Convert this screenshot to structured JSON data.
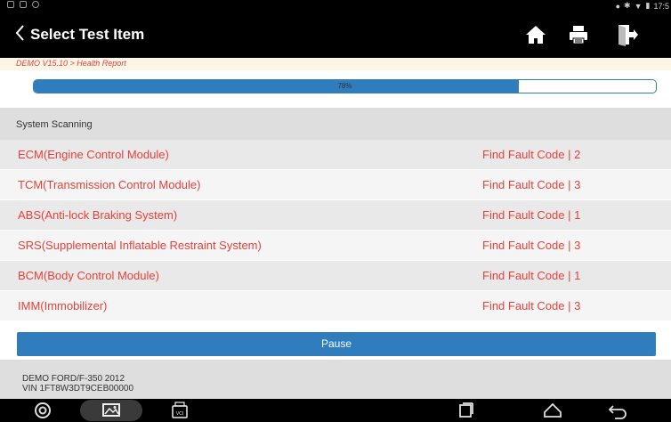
{
  "status_bar": {
    "time": "17:5"
  },
  "header": {
    "title": "Select Test Item",
    "icons": {
      "back": "back-chevron-icon",
      "home": "home-icon",
      "print": "printer-icon",
      "exit": "exit-icon"
    }
  },
  "breadcrumb": "DEMO V15.10 > Health Report",
  "progress": {
    "value": 0.78,
    "label": "78%"
  },
  "section": "System Scanning",
  "modules": [
    {
      "name": "ECM(Engine Control Module)",
      "status": "Find Fault Code | 2"
    },
    {
      "name": "TCM(Transmission Control Module)",
      "status": "Find Fault Code | 3"
    },
    {
      "name": "ABS(Anti-lock Braking System)",
      "status": "Find Fault Code | 1"
    },
    {
      "name": "SRS(Supplemental Inflatable Restraint System)",
      "status": "Find Fault Code | 3"
    },
    {
      "name": "BCM(Body Control Module)",
      "status": "Find Fault Code | 1"
    },
    {
      "name": "IMM(Immobilizer)",
      "status": "Find Fault Code | 3"
    }
  ],
  "pause_label": "Pause",
  "vehicle": {
    "model": "DEMO FORD/F-350 2012",
    "vin": "VIN 1FT8W3DT9CEB00000"
  },
  "nav_bar": {
    "vci_label": "VCI"
  },
  "colors": {
    "accent": "#2f7dbd",
    "fault_text": "#e9413a",
    "header_bg": "#000000"
  }
}
